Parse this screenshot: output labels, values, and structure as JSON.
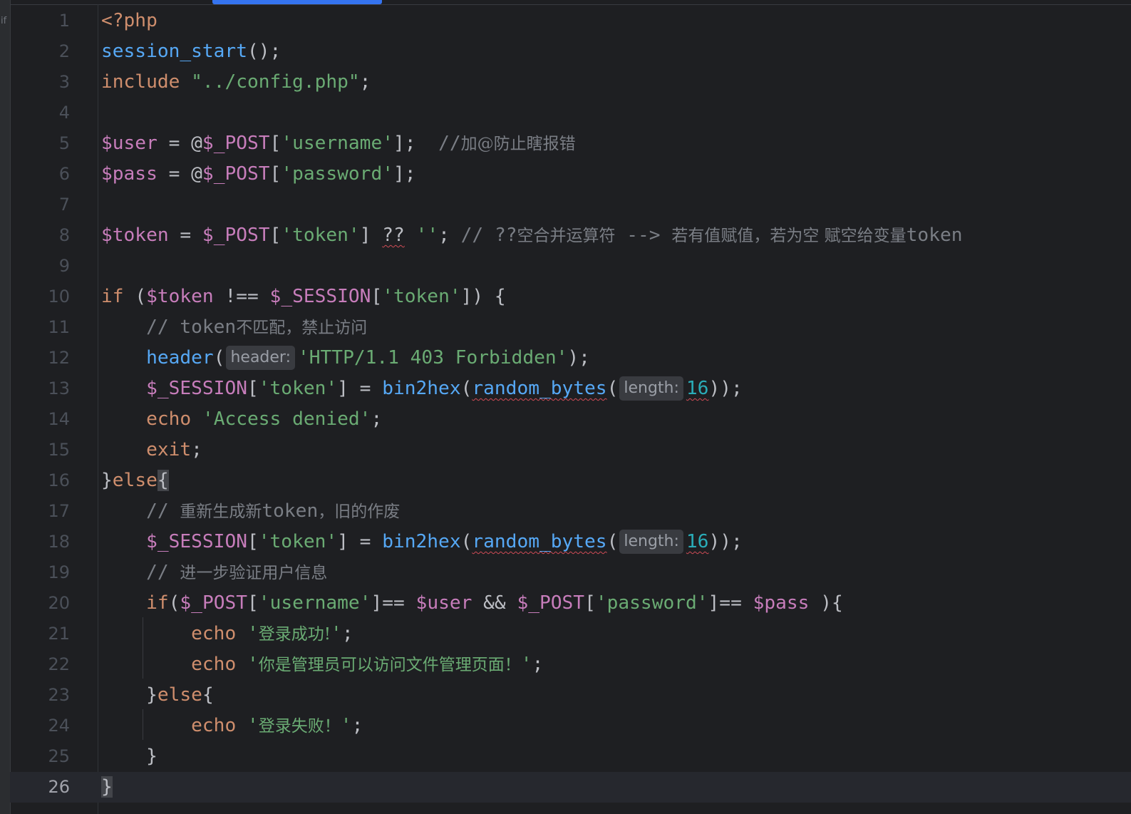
{
  "sidebar": {
    "label": "if"
  },
  "lines": [
    {
      "n": "1",
      "t": [
        {
          "s": "<?php",
          "c": "kw"
        }
      ]
    },
    {
      "n": "2",
      "t": [
        {
          "s": "session_start",
          "c": "fn"
        },
        {
          "s": "();",
          "c": "plain"
        }
      ]
    },
    {
      "n": "3",
      "t": [
        {
          "s": "include ",
          "c": "kw"
        },
        {
          "s": "\"../config.php\"",
          "c": "str"
        },
        {
          "s": ";",
          "c": "plain"
        }
      ]
    },
    {
      "n": "4",
      "t": []
    },
    {
      "n": "5",
      "t": [
        {
          "s": "$user",
          "c": "var"
        },
        {
          "s": " = @",
          "c": "plain"
        },
        {
          "s": "$_POST",
          "c": "var"
        },
        {
          "s": "[",
          "c": "plain"
        },
        {
          "s": "'username'",
          "c": "str"
        },
        {
          "s": "];  ",
          "c": "plain"
        },
        {
          "s": "//",
          "c": "cmt"
        },
        {
          "s": "加@防止瞎报错",
          "c": "cmt cjk"
        }
      ]
    },
    {
      "n": "6",
      "t": [
        {
          "s": "$pass",
          "c": "var"
        },
        {
          "s": " = @",
          "c": "plain"
        },
        {
          "s": "$_POST",
          "c": "var"
        },
        {
          "s": "[",
          "c": "plain"
        },
        {
          "s": "'password'",
          "c": "str"
        },
        {
          "s": "];",
          "c": "plain"
        }
      ]
    },
    {
      "n": "7",
      "t": []
    },
    {
      "n": "8",
      "t": [
        {
          "s": "$token",
          "c": "var"
        },
        {
          "s": " = ",
          "c": "plain"
        },
        {
          "s": "$_POST",
          "c": "var"
        },
        {
          "s": "[",
          "c": "plain"
        },
        {
          "s": "'token'",
          "c": "str"
        },
        {
          "s": "] ",
          "c": "plain"
        },
        {
          "s": "??",
          "c": "plain squig"
        },
        {
          "s": " ",
          "c": "plain"
        },
        {
          "s": "''",
          "c": "str"
        },
        {
          "s": "; ",
          "c": "plain"
        },
        {
          "s": "// ??",
          "c": "cmt"
        },
        {
          "s": "空合并运算符",
          "c": "cmt cjk"
        },
        {
          "s": " --> ",
          "c": "cmt"
        },
        {
          "s": "若有值赋值，若为空 赋空给变量",
          "c": "cmt cjk"
        },
        {
          "s": "token",
          "c": "cmt"
        }
      ]
    },
    {
      "n": "9",
      "t": []
    },
    {
      "n": "10",
      "t": [
        {
          "s": "if",
          "c": "kw"
        },
        {
          "s": " (",
          "c": "plain"
        },
        {
          "s": "$token",
          "c": "var"
        },
        {
          "s": " !== ",
          "c": "plain"
        },
        {
          "s": "$_SESSION",
          "c": "var"
        },
        {
          "s": "[",
          "c": "plain"
        },
        {
          "s": "'token'",
          "c": "str"
        },
        {
          "s": "]) {",
          "c": "plain"
        }
      ]
    },
    {
      "n": "11",
      "t": [
        {
          "s": "    // token",
          "c": "cmt"
        },
        {
          "s": "不匹配，禁止访问",
          "c": "cmt cjk"
        }
      ]
    },
    {
      "n": "12",
      "t": [
        {
          "s": "    ",
          "c": "plain"
        },
        {
          "s": "header",
          "c": "fn"
        },
        {
          "s": "(",
          "c": "plain"
        },
        {
          "hint": "header:"
        },
        {
          "s": "'HTTP/1.1 403 Forbidden'",
          "c": "str"
        },
        {
          "s": ");",
          "c": "plain"
        }
      ]
    },
    {
      "n": "13",
      "t": [
        {
          "s": "    ",
          "c": "plain"
        },
        {
          "s": "$_SESSION",
          "c": "var"
        },
        {
          "s": "[",
          "c": "plain"
        },
        {
          "s": "'token'",
          "c": "str"
        },
        {
          "s": "] = ",
          "c": "plain"
        },
        {
          "s": "bin2hex",
          "c": "fn"
        },
        {
          "s": "(",
          "c": "plain"
        },
        {
          "s": "random_bytes",
          "c": "fn squig"
        },
        {
          "s": "(",
          "c": "plain"
        },
        {
          "hint": "length:"
        },
        {
          "s": "16",
          "c": "num squig"
        },
        {
          "s": "));",
          "c": "plain"
        }
      ]
    },
    {
      "n": "14",
      "t": [
        {
          "s": "    ",
          "c": "plain"
        },
        {
          "s": "echo",
          "c": "kw"
        },
        {
          "s": " ",
          "c": "plain"
        },
        {
          "s": "'Access denied'",
          "c": "str"
        },
        {
          "s": ";",
          "c": "plain"
        }
      ]
    },
    {
      "n": "15",
      "t": [
        {
          "s": "    ",
          "c": "plain"
        },
        {
          "s": "exit",
          "c": "kw"
        },
        {
          "s": ";",
          "c": "plain"
        }
      ]
    },
    {
      "n": "16",
      "t": [
        {
          "s": "}",
          "c": "plain"
        },
        {
          "s": "else",
          "c": "kw"
        },
        {
          "s": "{",
          "c": "plain brace-hl"
        }
      ]
    },
    {
      "n": "17",
      "t": [
        {
          "s": "    // ",
          "c": "cmt"
        },
        {
          "s": "重新生成新",
          "c": "cmt cjk"
        },
        {
          "s": "token",
          "c": "cmt"
        },
        {
          "s": "，旧的作废",
          "c": "cmt cjk"
        }
      ]
    },
    {
      "n": "18",
      "t": [
        {
          "s": "    ",
          "c": "plain"
        },
        {
          "s": "$_SESSION",
          "c": "var"
        },
        {
          "s": "[",
          "c": "plain"
        },
        {
          "s": "'token'",
          "c": "str"
        },
        {
          "s": "] = ",
          "c": "plain"
        },
        {
          "s": "bin2hex",
          "c": "fn"
        },
        {
          "s": "(",
          "c": "plain"
        },
        {
          "s": "random_bytes",
          "c": "fn squig"
        },
        {
          "s": "(",
          "c": "plain"
        },
        {
          "hint": "length:"
        },
        {
          "s": "16",
          "c": "num squig"
        },
        {
          "s": "));",
          "c": "plain"
        }
      ]
    },
    {
      "n": "19",
      "t": [
        {
          "s": "    // ",
          "c": "cmt"
        },
        {
          "s": "进一步验证用户信息",
          "c": "cmt cjk"
        }
      ]
    },
    {
      "n": "20",
      "t": [
        {
          "s": "    ",
          "c": "plain"
        },
        {
          "s": "if",
          "c": "kw"
        },
        {
          "s": "(",
          "c": "plain"
        },
        {
          "s": "$_POST",
          "c": "var"
        },
        {
          "s": "[",
          "c": "plain"
        },
        {
          "s": "'username'",
          "c": "str"
        },
        {
          "s": "]== ",
          "c": "plain"
        },
        {
          "s": "$user",
          "c": "var"
        },
        {
          "s": " && ",
          "c": "plain"
        },
        {
          "s": "$_POST",
          "c": "var"
        },
        {
          "s": "[",
          "c": "plain"
        },
        {
          "s": "'password'",
          "c": "str"
        },
        {
          "s": "]== ",
          "c": "plain"
        },
        {
          "s": "$pass",
          "c": "var"
        },
        {
          "s": " ){",
          "c": "plain"
        }
      ]
    },
    {
      "n": "21",
      "t": [
        {
          "s": "        ",
          "c": "plain"
        },
        {
          "s": "echo",
          "c": "kw"
        },
        {
          "s": " ",
          "c": "plain"
        },
        {
          "s": "'",
          "c": "str"
        },
        {
          "s": "登录成功!",
          "c": "str cjk"
        },
        {
          "s": "'",
          "c": "str"
        },
        {
          "s": ";",
          "c": "plain"
        }
      ]
    },
    {
      "n": "22",
      "t": [
        {
          "s": "        ",
          "c": "plain"
        },
        {
          "s": "echo",
          "c": "kw"
        },
        {
          "s": " ",
          "c": "plain"
        },
        {
          "s": "'",
          "c": "str"
        },
        {
          "s": "你是管理员可以访问文件管理页面！",
          "c": "str cjk"
        },
        {
          "s": "'",
          "c": "str"
        },
        {
          "s": ";",
          "c": "plain"
        }
      ]
    },
    {
      "n": "23",
      "t": [
        {
          "s": "    ",
          "c": "plain"
        },
        {
          "s": "}",
          "c": "plain"
        },
        {
          "s": "else",
          "c": "kw"
        },
        {
          "s": "{",
          "c": "plain"
        }
      ]
    },
    {
      "n": "24",
      "t": [
        {
          "s": "        ",
          "c": "plain"
        },
        {
          "s": "echo",
          "c": "kw"
        },
        {
          "s": " ",
          "c": "plain"
        },
        {
          "s": "'",
          "c": "str"
        },
        {
          "s": "登录失败！",
          "c": "str cjk"
        },
        {
          "s": "'",
          "c": "str"
        },
        {
          "s": ";",
          "c": "plain"
        }
      ]
    },
    {
      "n": "25",
      "t": [
        {
          "s": "    }",
          "c": "plain"
        }
      ]
    },
    {
      "n": "26",
      "t": [
        {
          "s": "}",
          "c": "plain brace-hl"
        }
      ],
      "current": true
    }
  ]
}
